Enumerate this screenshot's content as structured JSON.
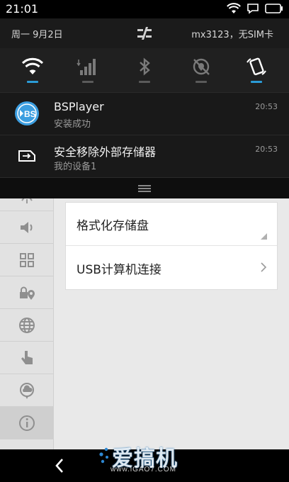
{
  "status_bar": {
    "time": "21:01",
    "icons": [
      "wifi-icon",
      "chat-icon",
      "battery-icon"
    ]
  },
  "shade_header": {
    "date": "周一 9月2日",
    "carrier": "mx3123，无SIM卡"
  },
  "quick_settings": [
    {
      "name": "wifi",
      "icon": "wifi-icon",
      "enabled": true
    },
    {
      "name": "mobile-data",
      "icon": "signal-icon",
      "enabled": false
    },
    {
      "name": "bluetooth",
      "icon": "bluetooth-icon",
      "enabled": false
    },
    {
      "name": "location",
      "icon": "location-icon",
      "enabled": false
    },
    {
      "name": "auto-rotate",
      "icon": "rotate-icon",
      "enabled": true
    }
  ],
  "notifications": [
    {
      "app": "BSPlayer",
      "subtitle": "安装成功",
      "time": "20:53",
      "icon": "bsplayer-icon"
    },
    {
      "app": "安全移除外部存储器",
      "subtitle": "我的设备1",
      "time": "20:53",
      "icon": "usb-storage-icon"
    }
  ],
  "settings_page": {
    "sidebar_icons": [
      "sound-icon",
      "apps-icon",
      "lock-location-icon",
      "globe-icon",
      "gesture-icon",
      "cloud-icon",
      "info-icon"
    ],
    "rows": [
      {
        "label": "格式化存储盘"
      },
      {
        "label": "USB计算机连接"
      }
    ]
  },
  "watermark": {
    "brand": "爱搞机",
    "url": "www.iGAO7.COM"
  },
  "colors": {
    "accent": "#2b9bd6",
    "shade_bg": "#111111",
    "page_bg": "#e9e9e9"
  }
}
